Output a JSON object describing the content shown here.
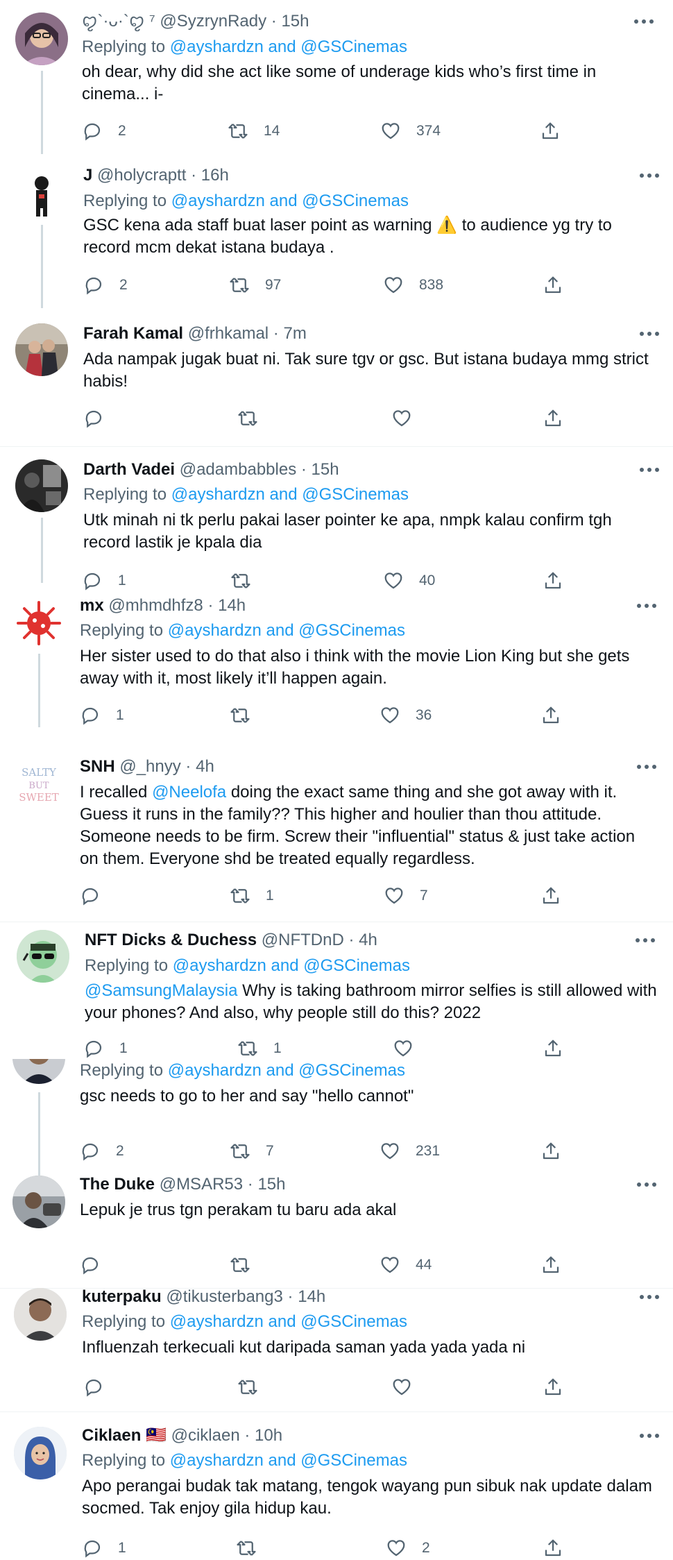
{
  "ui": {
    "replying_prefix": "Replying to ",
    "reply_targets": "@ayshardzn and @GSCinemas",
    "dot": "·"
  },
  "tweets": [
    {
      "name": "",
      "handle": "ꨄ︎`·ᴗ·`ꨄ︎ ⁷ @SyzrynRady",
      "time": "15h",
      "replying": true,
      "text": "oh dear, why did she act like some of underage kids who’s first time in cinema... i-",
      "replies": "2",
      "retweets": "14",
      "likes": "374"
    },
    {
      "name": "J",
      "handle": "@holycraptt",
      "time": "16h",
      "replying": true,
      "text": "GSC kena ada staff buat laser point as warning ⚠️ to audience yg try to record mcm dekat istana budaya .",
      "replies": "2",
      "retweets": "97",
      "likes": "838"
    },
    {
      "name": "Farah Kamal",
      "handle": "@frhkamal",
      "time": "7m",
      "replying": false,
      "text": "Ada nampak jugak buat ni. Tak sure tgv or gsc. But istana budaya mmg strict habis!",
      "replies": "",
      "retweets": "",
      "likes": ""
    },
    {
      "name": "Darth Vadei",
      "handle": "@adambabbles",
      "time": "15h",
      "replying": true,
      "text": "Utk minah ni tk perlu pakai laser pointer ke apa, nmpk kalau confirm tgh record lastik je kpala dia",
      "replies": "1",
      "retweets": "",
      "likes": "40"
    },
    {
      "name": "mx",
      "handle": "@mhmdhfz8",
      "time": "14h",
      "replying": true,
      "text": "Her sister used to do that also i think with the movie Lion King but she gets away with it, most likely it’ll happen again.",
      "replies": "1",
      "retweets": "",
      "likes": "36"
    },
    {
      "name": "SNH",
      "handle": "@_hnyy",
      "time": "4h",
      "replying": false,
      "text_pre": "I recalled ",
      "mention": "@Neelofa",
      "text": " doing the exact same thing and she got away with it. Guess it runs in the family?? This higher and houlier than thou attitude. Someone needs to be firm. Screw their \"influential\" status & just take action on them. Everyone shd be treated equally regardless.",
      "replies": "",
      "retweets": "1",
      "likes": "7"
    },
    {
      "name": "NFT Dicks & Duchess",
      "handle": "@NFTDnD",
      "time": "4h",
      "replying": true,
      "text_pre": "",
      "mention": "@SamsungMalaysia",
      "text": "  Why is taking bathroom mirror selfies is still allowed with your phones? And also, why people still do this? 2022",
      "replies": "1",
      "retweets": "1",
      "likes": ""
    },
    {
      "name": "",
      "handle": "",
      "time": "",
      "replying": true,
      "text": "gsc needs to go to her and say \"hello cannot\"",
      "replies": "2",
      "retweets": "7",
      "likes": "231"
    },
    {
      "name": "The Duke",
      "handle": "@MSAR53",
      "time": "15h",
      "replying": false,
      "text": "Lepuk je trus tgn perakam tu baru ada akal",
      "replies": "",
      "retweets": "",
      "likes": "44"
    },
    {
      "name": "kuterpaku",
      "handle": "@tikusterbang3",
      "time": "14h",
      "replying": true,
      "text": "Influenzah terkecuali kut daripada saman yada yada yada ni",
      "replies": "",
      "retweets": "",
      "likes": ""
    },
    {
      "name": "Ciklaen 🇲🇾",
      "handle": "@ciklaen",
      "time": "10h",
      "replying": true,
      "text": "Apo perangai budak tak matang, tengok wayang pun sibuk nak update dalam socmed. Tak enjoy gila hidup kau.",
      "replies": "1",
      "retweets": "",
      "likes": "2"
    }
  ]
}
